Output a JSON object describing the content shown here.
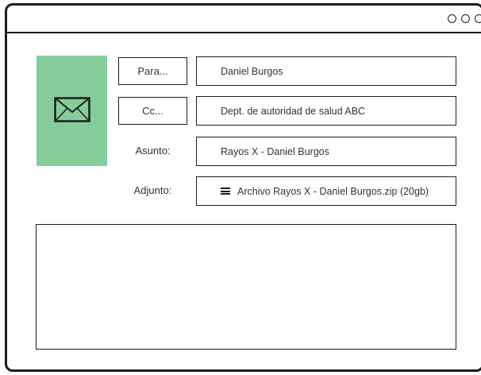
{
  "window": {
    "controls": [
      "circle-icon",
      "circle-icon",
      "circle-icon"
    ]
  },
  "brand": {
    "icon": "envelope-icon",
    "tile_color": "#86cd9c"
  },
  "compose": {
    "to": {
      "label": "Para...",
      "value": "Daniel Burgos"
    },
    "cc": {
      "label": "Cc...",
      "value": "Dept. de autoridad de salud ABC"
    },
    "subject": {
      "label": "Asunto:",
      "value": "Rayos X - Daniel Burgos"
    },
    "attachment": {
      "label": "Adjunto:",
      "icon": "file-lines-icon",
      "value": "Archivo Rayos X - Daniel Burgos.zip (20gb)"
    },
    "body": {
      "value": ""
    }
  }
}
